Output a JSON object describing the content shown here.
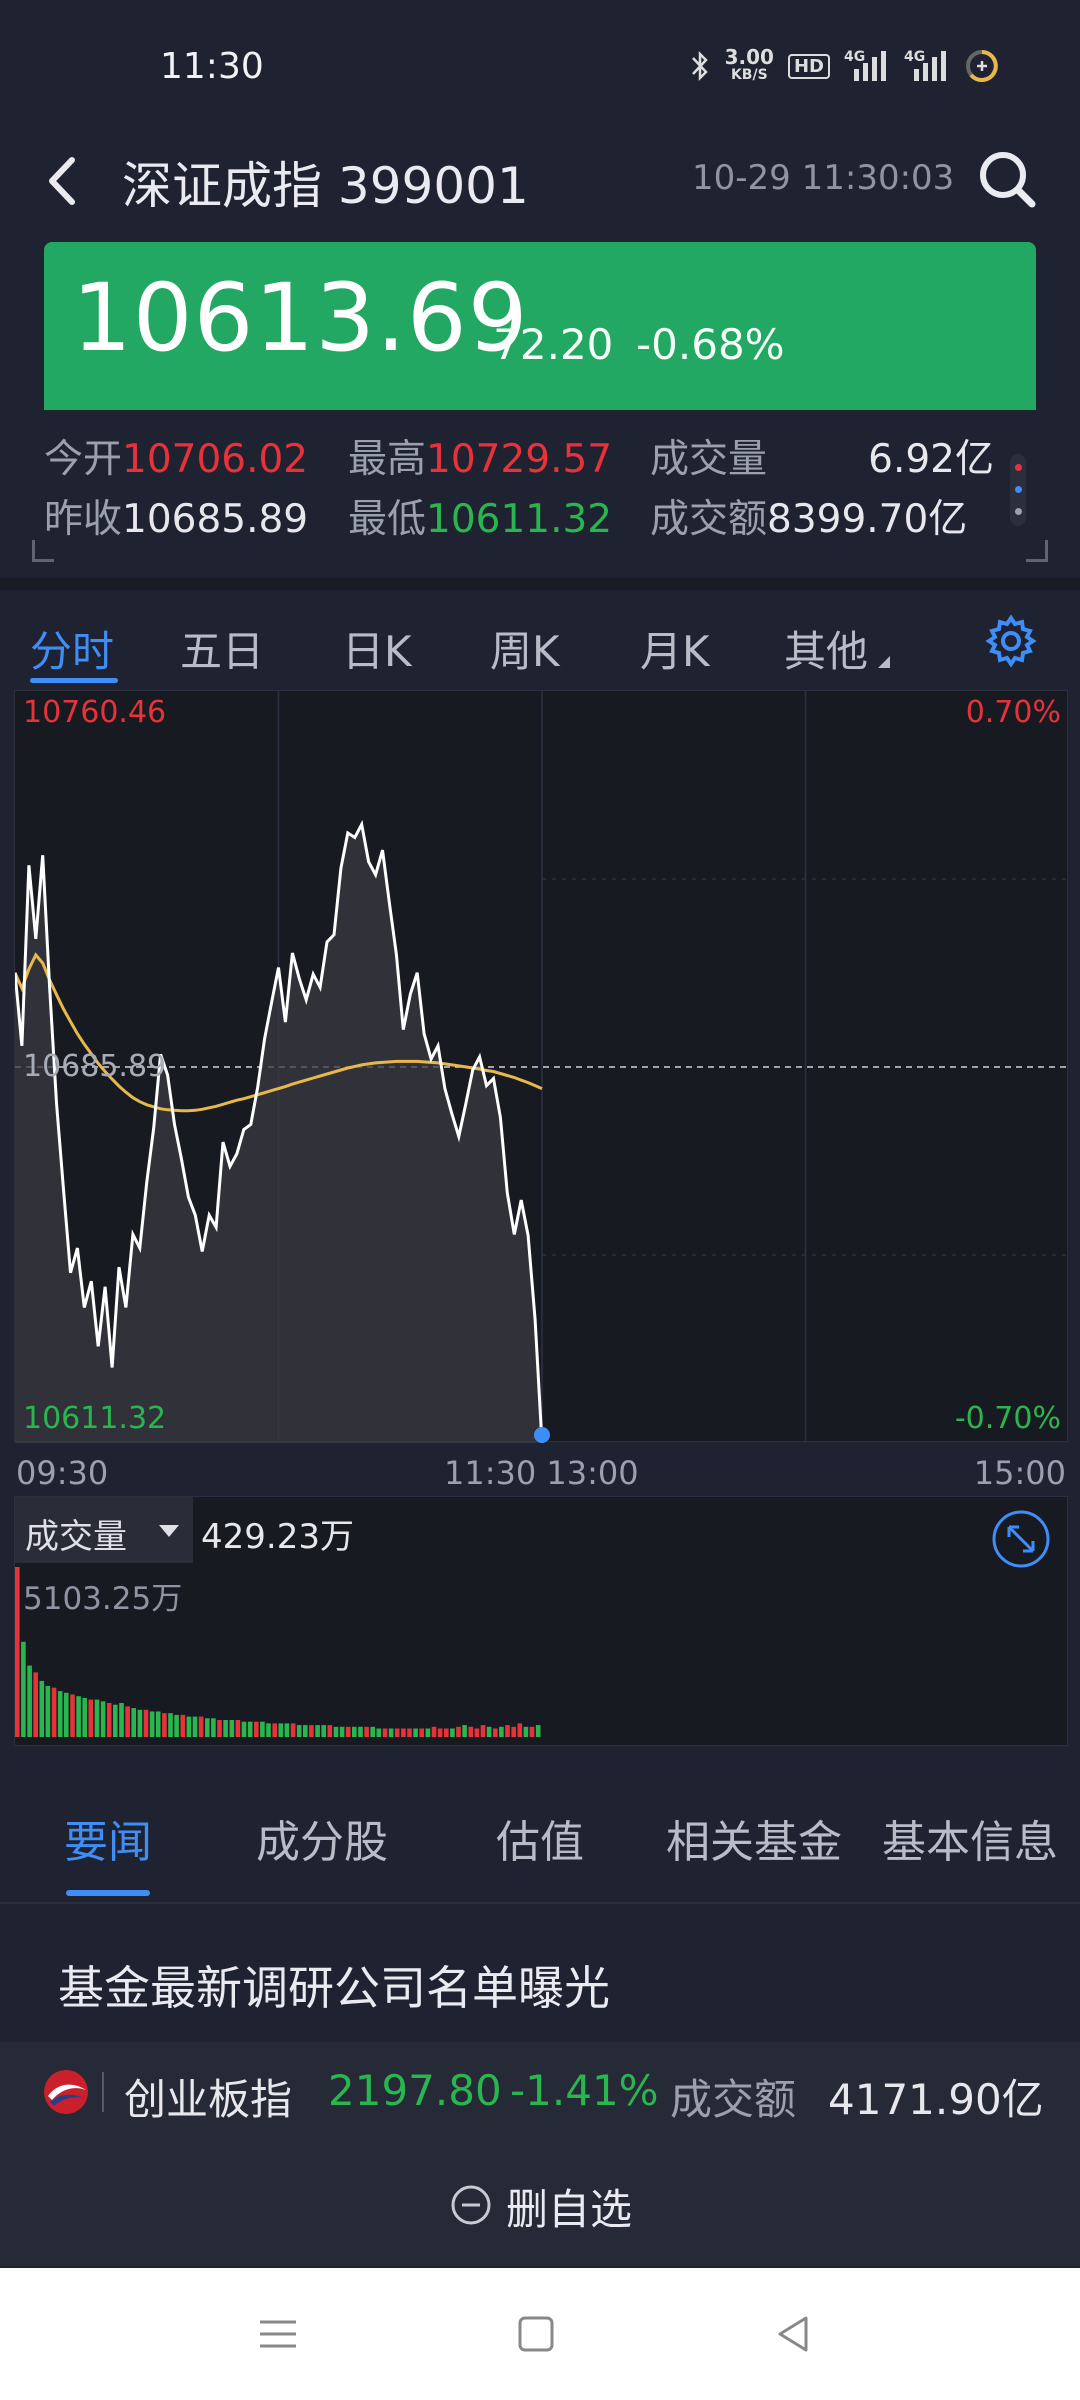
{
  "status": {
    "time": "11:30",
    "net_speed_value": "3.00",
    "net_speed_unit": "KB/S",
    "hd_badge": "HD",
    "signal_1": "4G",
    "signal_2": "4G"
  },
  "header": {
    "title": "深证成指 399001",
    "datetime": "10-29 11:30:03"
  },
  "quote": {
    "price": "10613.69",
    "change": "-72.20",
    "change_pct": "-0.68%",
    "banner_color": "#22a862"
  },
  "stats": {
    "open_label": "今开",
    "open_value": "10706.02",
    "high_label": "最高",
    "high_value": "10729.57",
    "volume_label": "成交量",
    "volume_value": "6.92亿",
    "prev_close_label": "昨收",
    "prev_close_value": "10685.89",
    "low_label": "最低",
    "low_value": "10611.32",
    "turnover_label": "成交额",
    "turnover_value": "8399.70亿"
  },
  "chart_tabs": {
    "items": [
      "分时",
      "五日",
      "日K",
      "周K",
      "月K",
      "其他"
    ],
    "active": 0
  },
  "chart_data": {
    "type": "line",
    "y_top_label": "10760.46",
    "y_bottom_label": "10611.32",
    "y_mid_label": "10685.89",
    "pct_top_label": "0.70%",
    "pct_bottom_label": "-0.70%",
    "ylim": [
      10611.32,
      10760.46
    ],
    "reference": 10685.89,
    "time_labels": [
      "09:30",
      "11:30 13:00",
      "15:00"
    ],
    "series": [
      {
        "values": [
          10704.6,
          10690.1,
          10725.9,
          10711.3,
          10727.9,
          10701.4,
          10678.5,
          10661.6,
          10645.1,
          10650.0,
          10638.2,
          10643.4,
          10630.5,
          10642.3,
          10626.3,
          10646.2,
          10638.2,
          10652.7,
          10650.0,
          10663.1,
          10673.8,
          10688.4,
          10684.3,
          10674.5,
          10667.7,
          10660.1,
          10656.5,
          10649.3,
          10656.5,
          10654.1,
          10671.0,
          10666.2,
          10668.7,
          10673.5,
          10674.5,
          10681.9,
          10691.5,
          10698.7,
          10705.6,
          10694.8,
          10708.5,
          10703.4,
          10699.2,
          10704.3,
          10701.7,
          10710.7,
          10712.1,
          10725.3,
          10732.3,
          10731.4,
          10734.0,
          10726.6,
          10724.0,
          10728.9,
          10718.4,
          10708.2,
          10693.3,
          10700.3,
          10704.6,
          10692.5,
          10687.5,
          10690.1,
          10681.6,
          10676.6,
          10672.1,
          10678.5,
          10685.3,
          10687.9,
          10682.2,
          10683.6,
          10675.9,
          10660.9,
          10652.7,
          10659.5,
          10652.5,
          10635.8,
          10611.32
        ],
        "color": "#ffffff"
      },
      {
        "values": [
          10704.6,
          10701.5,
          10705.3,
          10708.1,
          10706.5,
          10703.1,
          10700.2,
          10697.4,
          10694.9,
          10692.5,
          10690.4,
          10688.5,
          10686.6,
          10685.0,
          10683.5,
          10682.1,
          10680.9,
          10679.8,
          10679.0,
          10678.4,
          10678.0,
          10677.6,
          10677.4,
          10677.3,
          10677.2,
          10677.2,
          10677.3,
          10677.5,
          10677.8,
          10678.1,
          10678.5,
          10678.9,
          10679.3,
          10679.6,
          10680.0,
          10680.4,
          10680.8,
          10681.2,
          10681.6,
          10682.0,
          10682.5,
          10682.9,
          10683.3,
          10683.7,
          10684.1,
          10684.5,
          10684.9,
          10685.3,
          10685.7,
          10686.0,
          10686.3,
          10686.5,
          10686.7,
          10686.8,
          10686.9,
          10687.0,
          10687.0,
          10687.0,
          10687.0,
          10686.9,
          10686.8,
          10686.7,
          10686.5,
          10686.3,
          10686.1,
          10685.9,
          10685.7,
          10685.5,
          10685.2,
          10685.0,
          10684.6,
          10684.2,
          10683.8,
          10683.3,
          10682.8,
          10682.2,
          10681.6
        ],
        "color": "#e8b84a"
      }
    ]
  },
  "volume": {
    "label": "成交量",
    "value": "429.23万",
    "max_label": "5103.25万",
    "bars": [
      1.0,
      0.56,
      0.42,
      0.38,
      0.33,
      0.3,
      0.29,
      0.27,
      0.26,
      0.25,
      0.24,
      0.23,
      0.22,
      0.22,
      0.21,
      0.2,
      0.19,
      0.2,
      0.18,
      0.17,
      0.16,
      0.16,
      0.15,
      0.15,
      0.14,
      0.14,
      0.13,
      0.13,
      0.12,
      0.12,
      0.12,
      0.11,
      0.11,
      0.1,
      0.1,
      0.1,
      0.1,
      0.09,
      0.09,
      0.09,
      0.09,
      0.08,
      0.08,
      0.08,
      0.08,
      0.08,
      0.07,
      0.07,
      0.07,
      0.07,
      0.07,
      0.07,
      0.06,
      0.06,
      0.06,
      0.06,
      0.06,
      0.06,
      0.06,
      0.05,
      0.05,
      0.05,
      0.05,
      0.05,
      0.05,
      0.05,
      0.05,
      0.05,
      0.06,
      0.05,
      0.05,
      0.05,
      0.06,
      0.07,
      0.06,
      0.05,
      0.07,
      0.06,
      0.05,
      0.06,
      0.07,
      0.06,
      0.08,
      0.06,
      0.06,
      0.07
    ],
    "up_color": "#e8323a",
    "down_color": "#2ab64f"
  },
  "news_tabs": {
    "items": [
      "要闻",
      "成分股",
      "估值",
      "相关基金",
      "基本信息"
    ],
    "active": 0
  },
  "headline": "基金最新调研公司名单曝光",
  "related": {
    "name": "创业板指",
    "price": "2197.80",
    "change_pct": "-1.41%",
    "turnover_label": "成交额",
    "turnover_value": "4171.90亿"
  },
  "action": {
    "delete_label": "删自选"
  },
  "icons": {
    "back": "back-arrow-icon",
    "search": "search-icon",
    "settings": "gear-icon",
    "expand": "expand-icon",
    "remove": "minus-circle-icon",
    "logo": "chinext-logo-icon"
  }
}
